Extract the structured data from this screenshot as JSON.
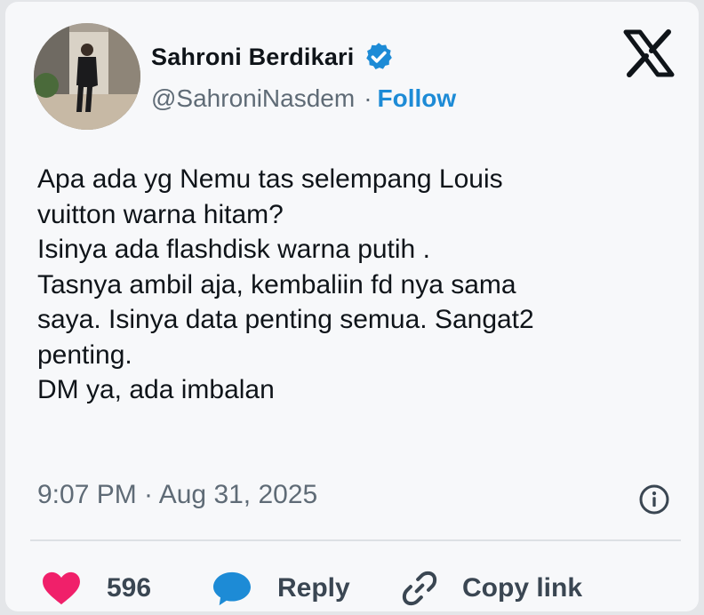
{
  "author": {
    "name": "Sahroni Berdikari",
    "handle": "@SahroniNasdem",
    "separator": "·",
    "follow_label": "Follow"
  },
  "tweet": {
    "lines": [
      "Apa ada yg Nemu tas selempang Louis",
      "vuitton warna hitam?",
      "Isinya ada flashdisk warna putih .",
      "Tasnya ambil aja, kembaliin fd nya sama",
      "saya. Isinya data penting semua. Sangat2",
      "penting.",
      "DM ya, ada imbalan"
    ],
    "timestamp": "9:07 PM · Aug 31, 2025"
  },
  "actions": {
    "like_count": "596",
    "reply_label": "Reply",
    "copy_link_label": "Copy link"
  },
  "icons": {
    "verified": "verified-badge-icon",
    "x_logo": "x-logo-icon",
    "info": "info-icon",
    "heart": "heart-icon",
    "reply": "reply-bubble-icon",
    "link": "link-icon"
  },
  "colors": {
    "accent": "#1d8bd6",
    "heart": "#f0206a",
    "reply_bubble": "#1d8bd6",
    "text": "#0f1419",
    "muted": "#5f6b76"
  }
}
